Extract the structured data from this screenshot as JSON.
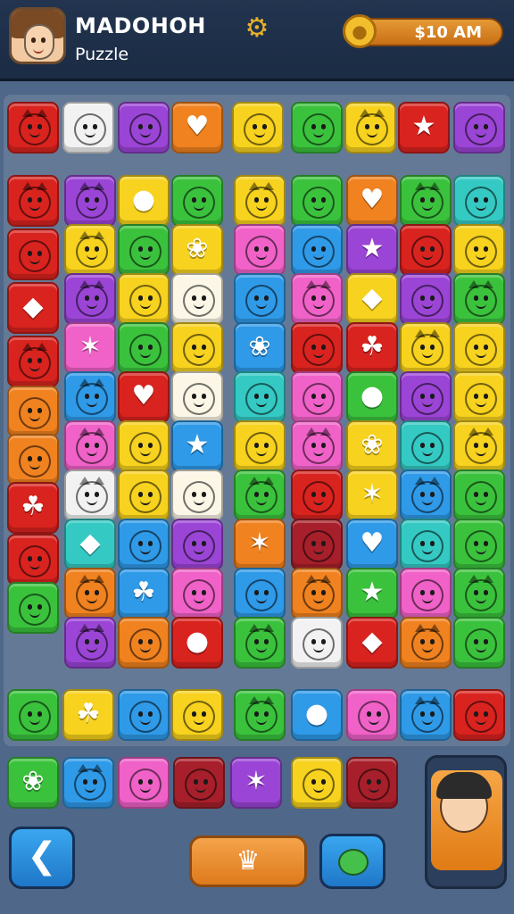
{
  "header": {
    "title": "MADOHOH",
    "subtitle": "Puzzle",
    "time": "$10 AM",
    "icons": {
      "avatar": "player-avatar",
      "settings": "gear-icon",
      "coin": "gold-coin-icon"
    }
  },
  "colors": {
    "red": "#d9231f",
    "white": "#f2f2f2",
    "purple": "#9b45d6",
    "orange": "#f0821f",
    "yellow": "#f7d21e",
    "green": "#3bc23d",
    "blue": "#2f9ae8",
    "pink": "#f062c8",
    "cream": "#fbf6e6",
    "teal": "#35c9c3",
    "darkred": "#a71f2a",
    "lime": "#8fdc3a"
  },
  "tiles": {
    "top_row": [
      "red",
      "white",
      "purple",
      "orange",
      "yellow",
      "green",
      "yellow",
      "red",
      "purple"
    ],
    "left_column": [
      "red",
      "red",
      "red",
      "red",
      "orange",
      "orange",
      "red",
      "red",
      "green"
    ],
    "grid_mid_left": [
      [
        "purple",
        "yellow",
        "green"
      ],
      [
        "yellow",
        "green",
        "yellow"
      ],
      [
        "purple",
        "yellow",
        "cream"
      ],
      [
        "pink",
        "green",
        "yellow"
      ],
      [
        "blue",
        "red",
        "cream"
      ],
      [
        "pink",
        "yellow",
        "blue"
      ],
      [
        "white",
        "yellow",
        "cream"
      ],
      [
        "teal",
        "blue",
        "purple"
      ],
      [
        "orange",
        "blue",
        "pink"
      ],
      [
        "purple",
        "orange",
        "red"
      ]
    ],
    "center_column": [
      "yellow",
      "pink",
      "blue",
      "blue",
      "teal",
      "yellow",
      "green",
      "orange",
      "blue",
      "green"
    ],
    "grid_mid_right": [
      [
        "green",
        "orange",
        "green",
        "teal"
      ],
      [
        "blue",
        "purple",
        "red",
        "yellow"
      ],
      [
        "pink",
        "yellow",
        "purple",
        "green"
      ],
      [
        "red",
        "red",
        "yellow",
        "yellow"
      ],
      [
        "pink",
        "green",
        "purple",
        "yellow"
      ],
      [
        "pink",
        "yellow",
        "teal",
        "yellow"
      ],
      [
        "red",
        "yellow",
        "blue",
        "green"
      ],
      [
        "darkred",
        "blue",
        "teal",
        "green"
      ],
      [
        "orange",
        "green",
        "pink",
        "green"
      ],
      [
        "white",
        "red",
        "orange",
        "green"
      ]
    ],
    "bottom_row": [
      "green",
      "yellow",
      "blue",
      "yellow",
      "green",
      "blue",
      "pink",
      "blue",
      "red"
    ],
    "tray_row": [
      "green",
      "blue",
      "pink",
      "darkred",
      "purple",
      "yellow",
      "darkred"
    ]
  },
  "controls": {
    "back": "back-arrow-icon",
    "hint": "hint-icon",
    "chat": "chat-icon",
    "helper": "helper-character-avatar"
  }
}
